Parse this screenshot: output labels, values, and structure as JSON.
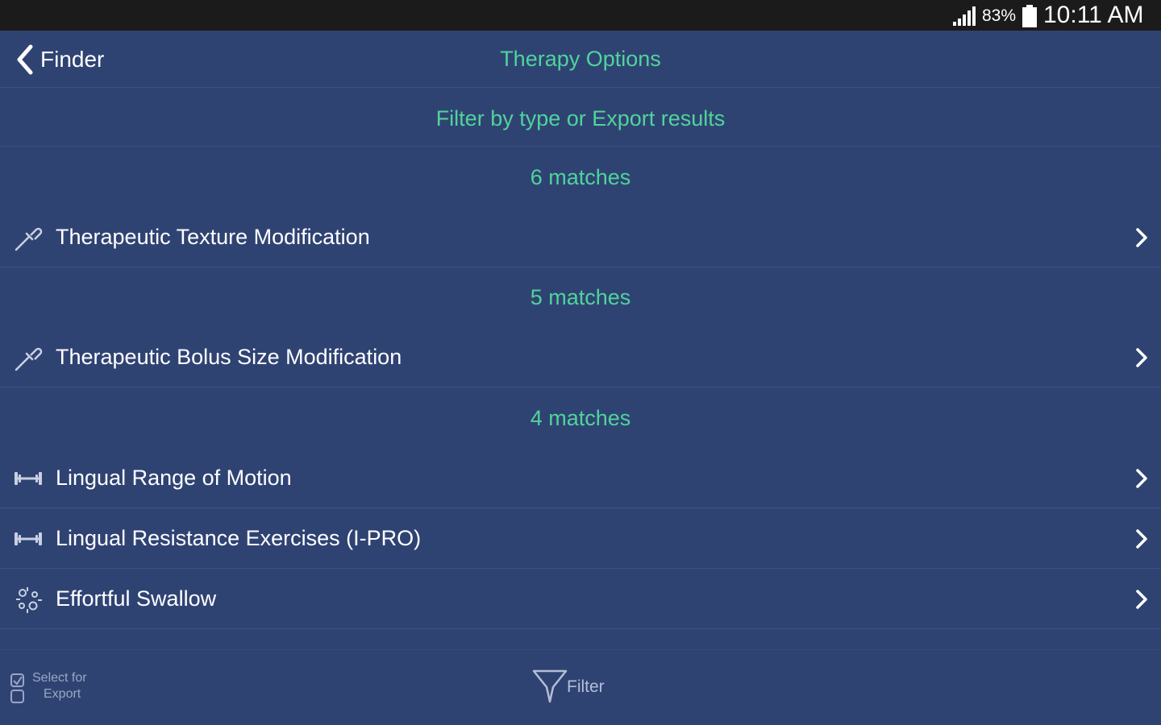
{
  "status_bar": {
    "battery_percent": "83%",
    "time": "10:11 AM",
    "signal_icon": "signal-bars-icon",
    "battery_icon": "battery-icon"
  },
  "nav": {
    "back_label": "Finder",
    "title": "Therapy Options"
  },
  "filter_export_link": "Filter by type or Export results",
  "sections": [
    {
      "header": "6 matches",
      "items": [
        {
          "label": "Therapeutic Texture Modification",
          "icon": "pipette-icon"
        }
      ]
    },
    {
      "header": "5 matches",
      "items": [
        {
          "label": "Therapeutic Bolus Size Modification",
          "icon": "pipette-icon"
        }
      ]
    },
    {
      "header": "4 matches",
      "items": [
        {
          "label": "Lingual Range of Motion",
          "icon": "dumbbell-icon"
        },
        {
          "label": "Lingual Resistance Exercises (I-PRO)",
          "icon": "dumbbell-icon"
        },
        {
          "label": "Effortful Swallow",
          "icon": "sparkle-icon"
        }
      ]
    }
  ],
  "toolbar": {
    "select_line1": "Select for",
    "select_line2": "Export",
    "filter_label": "Filter"
  },
  "colors": {
    "background": "#2f4373",
    "accent_green": "#4fd49b",
    "status_bar": "#1b1b1b"
  }
}
